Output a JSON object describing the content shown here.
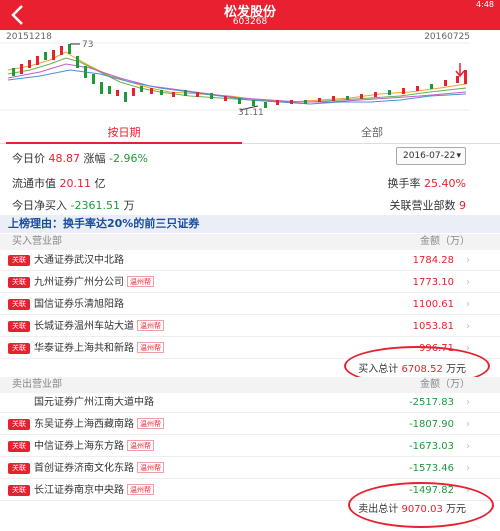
{
  "header": {
    "title": "松发股份",
    "code": "603268",
    "time": "4:48"
  },
  "chart": {
    "start_date": "20151218",
    "end_date": "20160725",
    "high_label": "73",
    "low_label": "31.11"
  },
  "tabs": {
    "active": "按日期",
    "inactive": "全部"
  },
  "stats": {
    "today_price_label": "今日价",
    "today_price": "48.87",
    "change_label": "涨幅",
    "change": "-2.96%",
    "date": "2016-07-22",
    "market_cap_label": "流通市值",
    "market_cap": "20.11",
    "market_cap_unit": "亿",
    "turnover_label": "换手率",
    "turnover": "25.40%",
    "net_buy_label": "今日净买入",
    "net_buy": "-2361.51",
    "net_buy_unit": "万",
    "related_label": "关联营业部数",
    "related": "9"
  },
  "reason": "上榜理由：换手率达20%的前三只证券",
  "buy": {
    "header_left": "买入营业部",
    "header_right": "金额（万）",
    "rows": [
      {
        "badge": "关联",
        "name": "大通证券武汉中北路",
        "tag": "",
        "value": "1784.28"
      },
      {
        "badge": "关联",
        "name": "九州证券广州分公司",
        "tag": "温州帮",
        "value": "1773.10"
      },
      {
        "badge": "关联",
        "name": "国信证券乐清旭阳路",
        "tag": "",
        "value": "1100.61"
      },
      {
        "badge": "关联",
        "name": "长城证券温州车站大道",
        "tag": "温州帮",
        "value": "1053.81"
      },
      {
        "badge": "关联",
        "name": "华泰证券上海共和新路",
        "tag": "温州帮",
        "value": "996.71"
      }
    ],
    "total_label": "买入总计",
    "total": "6708.52",
    "total_unit": "万元"
  },
  "sell": {
    "header_left": "卖出营业部",
    "header_right": "金额（万）",
    "rows": [
      {
        "badge": "",
        "name": "国元证券广州江南大道中路",
        "tag": "",
        "value": "-2517.83"
      },
      {
        "badge": "关联",
        "name": "东吴证券上海西藏南路",
        "tag": "温州帮",
        "value": "-1807.90"
      },
      {
        "badge": "关联",
        "name": "中信证券上海东方路",
        "tag": "温州帮",
        "value": "-1673.03"
      },
      {
        "badge": "关联",
        "name": "首创证券济南文化东路",
        "tag": "温州帮",
        "value": "-1573.46"
      },
      {
        "badge": "关联",
        "name": "长江证券南京中央路",
        "tag": "温州帮",
        "value": "-1497.82"
      }
    ],
    "total_label": "卖出总计",
    "total": "9070.03",
    "total_unit": "万元"
  },
  "colors": {
    "accent": "#e8202f",
    "down": "#1e9a3c"
  }
}
